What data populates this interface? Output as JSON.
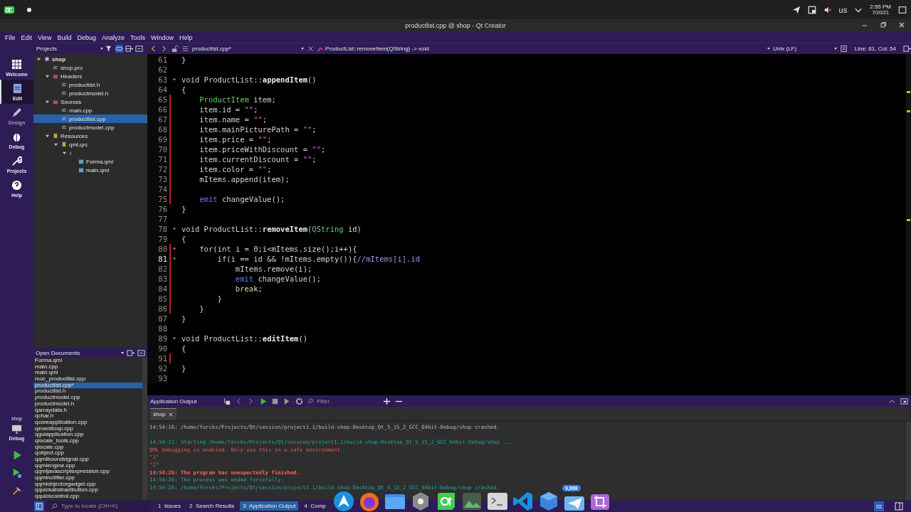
{
  "system_bar": {
    "keyboard": "us",
    "time": "2:55 PM",
    "date": "7/20/21"
  },
  "window": {
    "title": "productlist.cpp @ shop - Qt Creator"
  },
  "menu": [
    "File",
    "Edit",
    "View",
    "Build",
    "Debug",
    "Analyze",
    "Tools",
    "Window",
    "Help"
  ],
  "modes": [
    {
      "label": "Welcome",
      "kind": "welcome",
      "selected": false,
      "disabled": false
    },
    {
      "label": "Edit",
      "kind": "edit",
      "selected": true,
      "disabled": false
    },
    {
      "label": "Design",
      "kind": "design",
      "selected": false,
      "disabled": true
    },
    {
      "label": "Debug",
      "kind": "debug",
      "selected": false,
      "disabled": false
    },
    {
      "label": "Projects",
      "kind": "projects",
      "selected": false,
      "disabled": false
    },
    {
      "label": "Help",
      "kind": "help",
      "selected": false,
      "disabled": false
    }
  ],
  "run_target": {
    "project": "shop",
    "config": "Debug"
  },
  "sidebar": {
    "view": "Projects",
    "tree": [
      {
        "label": "shop",
        "kind": "project",
        "expanded": true,
        "selected": false,
        "children": [
          {
            "label": "shop.pro",
            "kind": "file",
            "selected": false
          },
          {
            "label": "Headers",
            "kind": "folder",
            "expanded": true,
            "selected": false,
            "children": [
              {
                "label": "productlist.h",
                "kind": "file",
                "selected": false
              },
              {
                "label": "productmodel.h",
                "kind": "file",
                "selected": false
              }
            ]
          },
          {
            "label": "Sources",
            "kind": "folder",
            "expanded": true,
            "selected": false,
            "children": [
              {
                "label": "main.cpp",
                "kind": "file",
                "selected": false
              },
              {
                "label": "productlist.cpp",
                "kind": "file",
                "selected": true
              },
              {
                "label": "productmodel.cpp",
                "kind": "file",
                "selected": false
              }
            ]
          },
          {
            "label": "Resources",
            "kind": "resource",
            "expanded": true,
            "selected": false,
            "children": [
              {
                "label": "qml.qrc",
                "kind": "resource",
                "expanded": true,
                "selected": false,
                "children": [
                  {
                    "label": "/",
                    "expanded": true,
                    "selected": false,
                    "children": [
                      {
                        "label": "Forma.qml",
                        "kind": "qml",
                        "selected": false
                      },
                      {
                        "label": "main.qml",
                        "kind": "qml",
                        "selected": false
                      }
                    ]
                  }
                ]
              }
            ]
          }
        ]
      }
    ],
    "open_documents": {
      "title": "Open Documents",
      "items": [
        {
          "label": "Forma.qml",
          "selected": false
        },
        {
          "label": "main.cpp",
          "selected": false
        },
        {
          "label": "main.qml",
          "selected": false
        },
        {
          "label": "moc_productlist.cpp",
          "selected": false
        },
        {
          "label": "productlist.cpp*",
          "selected": true
        },
        {
          "label": "productlist.h",
          "selected": false
        },
        {
          "label": "productmodel.cpp",
          "selected": false
        },
        {
          "label": "productmodel.h",
          "selected": false
        },
        {
          "label": "qarraydata.h",
          "selected": false
        },
        {
          "label": "qchar.h",
          "selected": false
        },
        {
          "label": "qcoreapplication.cpp",
          "selected": false
        },
        {
          "label": "qeventloop.cpp",
          "selected": false
        },
        {
          "label": "qguiapplication.cpp",
          "selected": false
        },
        {
          "label": "qlocale_tools.cpp",
          "selected": false
        },
        {
          "label": "qlocale.cpp",
          "selected": false
        },
        {
          "label": "qobject.cpp",
          "selected": false
        },
        {
          "label": "qqmlboundsignal.cpp",
          "selected": false
        },
        {
          "label": "qqmlengine.cpp",
          "selected": false
        },
        {
          "label": "qqmljavascriptexpression.cpp",
          "selected": false
        },
        {
          "label": "qqmlnotifier.cpp",
          "selected": false
        },
        {
          "label": "qqmlobjectorgadget.cpp",
          "selected": false
        },
        {
          "label": "qquickabstractbutton.cpp",
          "selected": false
        },
        {
          "label": "qquickcontrol.cpp",
          "selected": false
        }
      ]
    }
  },
  "editor": {
    "file": "productlist.cpp*",
    "symbol": "ProductList::removeItem(QString) -> void",
    "line_ending": "Unix (LF)",
    "position": "Line: 81, Col: 54",
    "lines": [
      {
        "num": "61",
        "modified": false,
        "fold": false,
        "current": false,
        "tokens": [
          {
            "kind": "plain",
            "text": "}"
          }
        ]
      },
      {
        "num": "62",
        "modified": false,
        "fold": false,
        "current": false
      },
      {
        "num": "63",
        "modified": false,
        "fold": true,
        "current": false,
        "tokens": [
          {
            "kind": "kw",
            "text": "void"
          },
          {
            "kind": "plain",
            "text": " ProductList::"
          },
          {
            "kind": "fn",
            "text": "appendItem"
          },
          {
            "kind": "plain",
            "text": "()"
          }
        ]
      },
      {
        "num": "64",
        "modified": false,
        "fold": false,
        "current": false,
        "tokens": [
          {
            "kind": "plain",
            "text": "{"
          }
        ]
      },
      {
        "num": "65",
        "modified": true,
        "fold": false,
        "current": false,
        "tokens": [
          {
            "kind": "type",
            "text": "    ProductItem"
          },
          {
            "kind": "plain",
            "text": " item;"
          }
        ]
      },
      {
        "num": "66",
        "modified": true,
        "fold": false,
        "current": false,
        "tokens": [
          {
            "kind": "plain",
            "text": "    item.id = "
          },
          {
            "kind": "str",
            "text": "\"\""
          },
          {
            "kind": "plain",
            "text": ";"
          }
        ]
      },
      {
        "num": "67",
        "modified": true,
        "fold": false,
        "current": false,
        "tokens": [
          {
            "kind": "plain",
            "text": "    item.name = "
          },
          {
            "kind": "str",
            "text": "\"\""
          },
          {
            "kind": "plain",
            "text": ";"
          }
        ]
      },
      {
        "num": "68",
        "modified": true,
        "fold": false,
        "current": false,
        "tokens": [
          {
            "kind": "plain",
            "text": "    item.mainPicturePath = "
          },
          {
            "kind": "str",
            "text": "\"\""
          },
          {
            "kind": "plain",
            "text": ";"
          }
        ]
      },
      {
        "num": "69",
        "modified": true,
        "fold": false,
        "current": false,
        "tokens": [
          {
            "kind": "plain",
            "text": "    item.price = "
          },
          {
            "kind": "str",
            "text": "\"\""
          },
          {
            "kind": "plain",
            "text": ";"
          }
        ]
      },
      {
        "num": "70",
        "modified": true,
        "fold": false,
        "current": false,
        "tokens": [
          {
            "kind": "plain",
            "text": "    item.priceWithDiscount = "
          },
          {
            "kind": "str",
            "text": "\"\""
          },
          {
            "kind": "plain",
            "text": ";"
          }
        ]
      },
      {
        "num": "71",
        "modified": true,
        "fold": false,
        "current": false,
        "tokens": [
          {
            "kind": "plain",
            "text": "    item.currentDiscount = "
          },
          {
            "kind": "str",
            "text": "\"\""
          },
          {
            "kind": "plain",
            "text": ";"
          }
        ]
      },
      {
        "num": "72",
        "modified": true,
        "fold": false,
        "current": false,
        "tokens": [
          {
            "kind": "plain",
            "text": "    item.color = "
          },
          {
            "kind": "str",
            "text": "\"\""
          },
          {
            "kind": "plain",
            "text": ";"
          }
        ]
      },
      {
        "num": "73",
        "modified": true,
        "fold": false,
        "current": false,
        "tokens": [
          {
            "kind": "plain",
            "text": "    mItems.append(item);"
          }
        ]
      },
      {
        "num": "74",
        "modified": true,
        "fold": false,
        "current": false
      },
      {
        "num": "75",
        "modified": true,
        "fold": false,
        "current": false,
        "tokens": [
          {
            "kind": "emit",
            "text": "    emit"
          },
          {
            "kind": "plain",
            "text": " changeValue();"
          }
        ]
      },
      {
        "num": "76",
        "modified": false,
        "fold": false,
        "current": false,
        "tokens": [
          {
            "kind": "plain",
            "text": "}"
          }
        ]
      },
      {
        "num": "77",
        "modified": false,
        "fold": false,
        "current": false
      },
      {
        "num": "78",
        "modified": false,
        "fold": true,
        "current": false,
        "tokens": [
          {
            "kind": "kw",
            "text": "void"
          },
          {
            "kind": "plain",
            "text": " ProductList::"
          },
          {
            "kind": "fn",
            "text": "removeItem"
          },
          {
            "kind": "plain",
            "text": "("
          },
          {
            "kind": "type",
            "text": "QString"
          },
          {
            "kind": "plain",
            "text": " id)"
          }
        ]
      },
      {
        "num": "79",
        "modified": false,
        "fold": false,
        "current": false,
        "tokens": [
          {
            "kind": "plain",
            "text": "{"
          }
        ]
      },
      {
        "num": "80",
        "modified": true,
        "fold": true,
        "current": false,
        "tokens": [
          {
            "kind": "kw",
            "text": "    for"
          },
          {
            "kind": "plain",
            "text": "("
          },
          {
            "kind": "kw",
            "text": "int"
          },
          {
            "kind": "plain",
            "text": " i = 0;i<mItems.size();i++){"
          }
        ]
      },
      {
        "num": "81",
        "modified": true,
        "fold": true,
        "current": true,
        "tokens": [
          {
            "kind": "kw",
            "text": "        if"
          },
          {
            "kind": "plain",
            "text": "(i == id && !mItems.empty()){"
          },
          {
            "kind": "comment",
            "text": "//mItems[i].id"
          }
        ]
      },
      {
        "num": "82",
        "modified": true,
        "fold": false,
        "current": false,
        "tokens": [
          {
            "kind": "plain",
            "text": "            mItems.remove(i);"
          }
        ]
      },
      {
        "num": "83",
        "modified": true,
        "fold": false,
        "current": false,
        "tokens": [
          {
            "kind": "emit",
            "text": "            emit"
          },
          {
            "kind": "plain",
            "text": " changeValue();"
          }
        ]
      },
      {
        "num": "84",
        "modified": true,
        "fold": false,
        "current": false,
        "tokens": [
          {
            "kind": "kw",
            "text": "            break"
          },
          {
            "kind": "plain",
            "text": ";"
          }
        ]
      },
      {
        "num": "85",
        "modified": true,
        "fold": false,
        "current": false,
        "tokens": [
          {
            "kind": "plain",
            "text": "        }"
          }
        ]
      },
      {
        "num": "86",
        "modified": true,
        "fold": false,
        "current": false,
        "tokens": [
          {
            "kind": "plain",
            "text": "    }"
          }
        ]
      },
      {
        "num": "87",
        "modified": false,
        "fold": false,
        "current": false,
        "tokens": [
          {
            "kind": "plain",
            "text": "}"
          }
        ]
      },
      {
        "num": "88",
        "modified": false,
        "fold": false,
        "current": false
      },
      {
        "num": "89",
        "modified": false,
        "fold": true,
        "current": false,
        "tokens": [
          {
            "kind": "kw",
            "text": "void"
          },
          {
            "kind": "plain",
            "text": " ProductList::"
          },
          {
            "kind": "fn",
            "text": "editItem"
          },
          {
            "kind": "plain",
            "text": "()"
          }
        ]
      },
      {
        "num": "90",
        "modified": false,
        "fold": false,
        "current": false,
        "tokens": [
          {
            "kind": "plain",
            "text": "{"
          }
        ]
      },
      {
        "num": "91",
        "modified": true,
        "fold": false,
        "current": false
      },
      {
        "num": "92",
        "modified": false,
        "fold": false,
        "current": false,
        "tokens": [
          {
            "kind": "plain",
            "text": "}"
          }
        ]
      },
      {
        "num": "93",
        "modified": false,
        "fold": false,
        "current": false
      }
    ]
  },
  "output": {
    "title": "Application Output",
    "filter_placeholder": "Filter",
    "tabs": [
      {
        "label": "shop",
        "selected": true
      }
    ],
    "lines": [
      {
        "kind": "plain",
        "text": "14:54:16: /home/forcks/Projects/Qt/session/project1.1/build-shop-Desktop_Qt_5_15_2_GCC_64bit-Debug/shop crashed."
      },
      {
        "kind": "gap"
      },
      {
        "kind": "info",
        "text": "14:54:21: Starting /home/forcks/Projects/Qt/session/project1.1/build-shop-Desktop_Qt_5_15_2_GCC_64bit-Debug/shop ..."
      },
      {
        "kind": "error",
        "text": "QML debugging is enabled. Only use this in a safe environment."
      },
      {
        "kind": "error",
        "text": "\"1\""
      },
      {
        "kind": "error",
        "text": "\"2\""
      },
      {
        "kind": "fatal",
        "text": "14:54:26: The program has unexpectedly finished."
      },
      {
        "kind": "info",
        "text": "14:54:26: The process was ended forcefully."
      },
      {
        "kind": "info",
        "text": "14:54:26: /home/forcks/Projects/Qt/session/project1.1/build-shop-Desktop_Qt_5_15_2_GCC_64bit-Debug/shop crashed."
      }
    ]
  },
  "status_bar": {
    "locator_placeholder": "Type to locate (Ctrl+K)",
    "panes": [
      {
        "num": "1",
        "label": "Issues",
        "selected": false
      },
      {
        "num": "2",
        "label": "Search Results",
        "selected": false
      },
      {
        "num": "3",
        "label": "Application Output",
        "selected": true
      },
      {
        "num": "4",
        "label": "Comp",
        "selected": false
      }
    ]
  },
  "dock": {
    "badge": "9,999"
  }
}
